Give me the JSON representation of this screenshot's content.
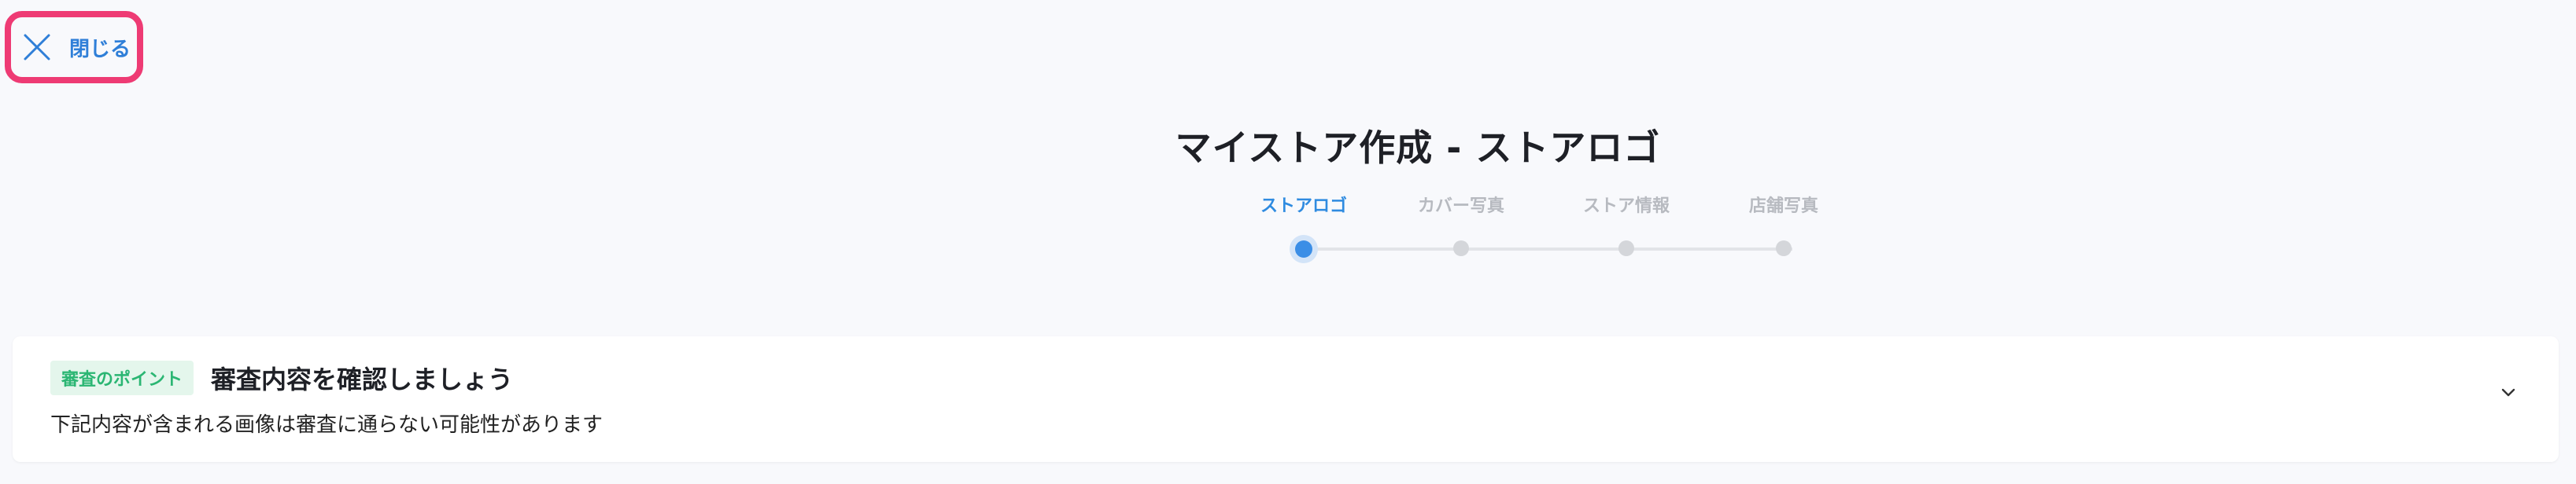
{
  "close": {
    "label": "閉じる",
    "icon": "close-icon"
  },
  "title": "マイストア作成 - ストアロゴ",
  "stepper": {
    "steps": [
      {
        "label": "ストアロゴ",
        "active": true
      },
      {
        "label": "カバー写真",
        "active": false
      },
      {
        "label": "ストア情報",
        "active": false
      },
      {
        "label": "店舗写真",
        "active": false
      }
    ]
  },
  "review": {
    "badge": "審査のポイント",
    "title": "審査内容を確認しましょう",
    "description": "下記内容が含まれる画像は審査に通らない可能性があります",
    "expand_icon": "chevron-down-icon"
  },
  "colors": {
    "accent": "#2f8be0",
    "highlight_border": "#ee3b74",
    "badge_bg": "#e4f6ec",
    "badge_text": "#2bb673"
  }
}
